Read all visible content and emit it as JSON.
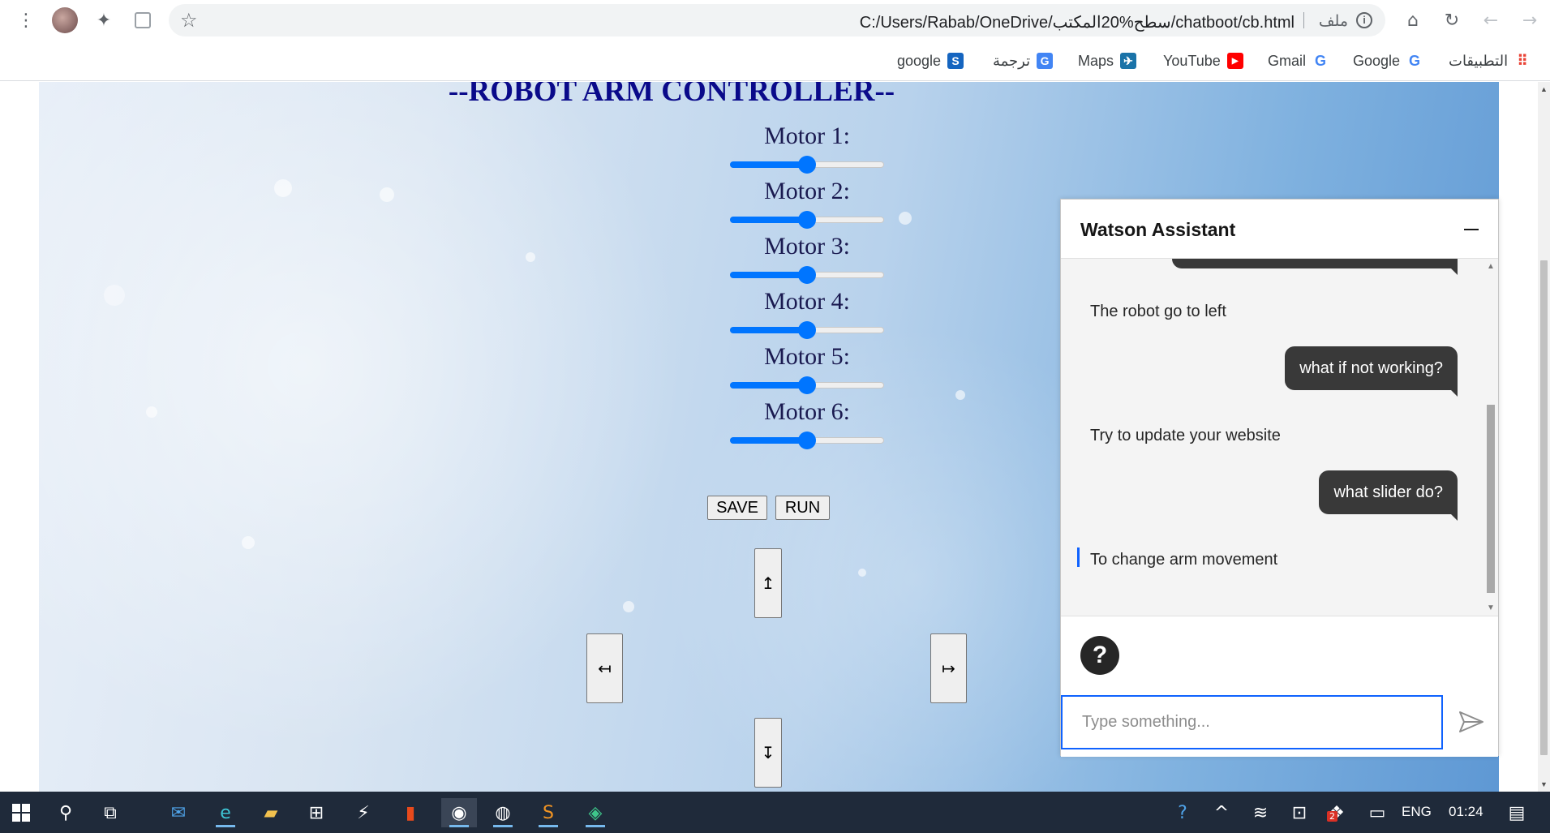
{
  "browser": {
    "url": "C:/Users/Rabab/OneDrive/سطح%20المكتب/chatboot/cb.html",
    "file_label": "ملف",
    "bookmarks": [
      {
        "label": "التطبيقات",
        "icon": "apps-grid-icon"
      },
      {
        "label": "Google",
        "icon": "google-icon"
      },
      {
        "label": "Gmail",
        "icon": "google-icon"
      },
      {
        "label": "YouTube",
        "icon": "youtube-icon"
      },
      {
        "label": "Maps",
        "icon": "maps-icon"
      },
      {
        "label": "ترجمة",
        "icon": "translate-icon"
      },
      {
        "label": "google",
        "icon": "s-icon"
      }
    ]
  },
  "page": {
    "title": "--ROBOT ARM CONTROLLER--",
    "motors": [
      {
        "label": "Motor 1:",
        "value": 0.5
      },
      {
        "label": "Motor 2:",
        "value": 0.5
      },
      {
        "label": "Motor 3:",
        "value": 0.5
      },
      {
        "label": "Motor 4:",
        "value": 0.5
      },
      {
        "label": "Motor 5:",
        "value": 0.5
      },
      {
        "label": "Motor 6:",
        "value": 0.5
      }
    ],
    "save_label": "SAVE",
    "run_label": "RUN",
    "arrows": {
      "up": "↥",
      "down": "↧",
      "left": "↤",
      "right": "↦"
    }
  },
  "assistant": {
    "title": "Watson Assistant",
    "messages": [
      {
        "from": "bot",
        "text": "The robot go to left"
      },
      {
        "from": "user",
        "text": "what if not working?"
      },
      {
        "from": "bot",
        "text": "Try to update your website"
      },
      {
        "from": "user",
        "text": "what slider do?"
      },
      {
        "from": "bot",
        "text": "To change arm movement"
      }
    ],
    "input_placeholder": "Type something...",
    "help_label": "?"
  },
  "taskbar": {
    "lang": "ENG",
    "time": "01:24",
    "notification_badge": "2"
  },
  "colors": {
    "slider_accent": "#0075ff",
    "title_color": "#0a0a8a",
    "user_bubble": "#393939",
    "focus_blue": "#0f62fe"
  }
}
